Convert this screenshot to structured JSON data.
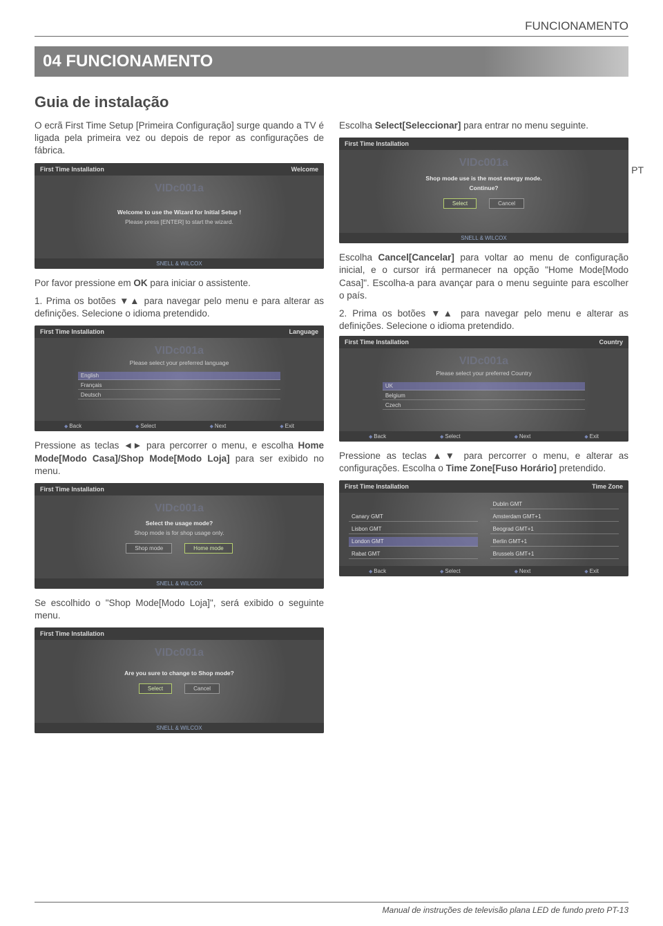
{
  "header": {
    "running": "FUNCIONAMENTO"
  },
  "banner": "04 FUNCIONAMENTO",
  "subheading": "Guia de instalação",
  "side_tab": "PT",
  "left": {
    "p1": "O ecrã First Time Setup [Primeira Configuração] surge quando a TV é ligada pela primeira vez ou depois de repor as configurações de fábrica.",
    "p2_a": "Por favor pressione em ",
    "p2_b": "OK",
    "p2_c": " para iniciar o assistente.",
    "p3": "1. Prima os botões ▼▲ para navegar pelo menu e para alterar as definições. Selecione o idioma pretendido.",
    "p4_a": "Pressione as teclas ◄► para percorrer o menu, e escolha ",
    "p4_b": "Home Mode[Modo Casa]/Shop Mode[Modo Loja]",
    "p4_c": " para ser exibido no menu.",
    "p5": "Se escolhido o \"Shop Mode[Modo Loja]\", será exibido o seguinte menu."
  },
  "right": {
    "p1_a": "Escolha ",
    "p1_b": "Select[Seleccionar]",
    "p1_c": " para entrar no menu seguinte.",
    "p2_a": "Escolha ",
    "p2_b": "Cancel[Cancelar]",
    "p2_c": " para voltar ao menu de configuração inicial, e o cursor irá permanecer na opção \"Home Mode[Modo Casa]\". Escolha-a para avançar para o menu seguinte para escolher o país.",
    "p3": "2. Prima os botões ▼▲ para navegar pelo menu e alterar as definições. Selecione o idioma pretendido.",
    "p4_a": "Pressione as teclas ▲▼ para percorrer o menu, e alterar as configurações. Escolha o ",
    "p4_b": "Time Zone[Fuso Horário]",
    "p4_c": " pretendido."
  },
  "shots": {
    "s1": {
      "title_l": "First Time Installation",
      "title_r": "Welcome",
      "l1": "Welcome to use the Wizard for Initial Setup !",
      "l2": "Please press [ENTER] to start the wizard.",
      "brand": "SNELL & WILCOX"
    },
    "s2": {
      "title_l": "First Time Installation",
      "title_r": "Language",
      "prompt": "Please select your preferred language",
      "opts": [
        "English",
        "Français",
        "Deutsch"
      ],
      "foot": [
        "Back",
        "Select",
        "Next",
        "Exit"
      ]
    },
    "s3": {
      "title_l": "First Time Installation",
      "l1": "Select the usage mode?",
      "l2": "Shop mode is for shop usage only.",
      "btns": [
        "Shop mode",
        "Home mode"
      ]
    },
    "s4": {
      "title_l": "First Time Installation",
      "l1": "Are you sure to change to Shop mode?",
      "btns": [
        "Select",
        "Cancel"
      ]
    },
    "s5": {
      "title_l": "First Time Installation",
      "l1": "Shop mode use is the most energy mode.",
      "l2": "Continue?",
      "btns": [
        "Select",
        "Cancel"
      ]
    },
    "s6": {
      "title_l": "First Time Installation",
      "title_r": "Country",
      "prompt": "Please select your preferred Country",
      "opts": [
        "UK",
        "Belgium",
        "Czech"
      ],
      "foot": [
        "Back",
        "Select",
        "Next",
        "Exit"
      ]
    },
    "s7": {
      "title_l": "First Time Installation",
      "title_r": "Time Zone",
      "cells": [
        "",
        "Dublin GMT",
        "Canary GMT",
        "Amsterdam GMT+1",
        "Lisbon GMT",
        "Beograd GMT+1",
        "London GMT",
        "Berlin GMT+1",
        "Rabat GMT",
        "Brussels GMT+1"
      ],
      "foot": [
        "Back",
        "Select",
        "Next",
        "Exit"
      ]
    }
  },
  "footer": "Manual de instruções de televisão plana LED de fundo preto PT-13"
}
